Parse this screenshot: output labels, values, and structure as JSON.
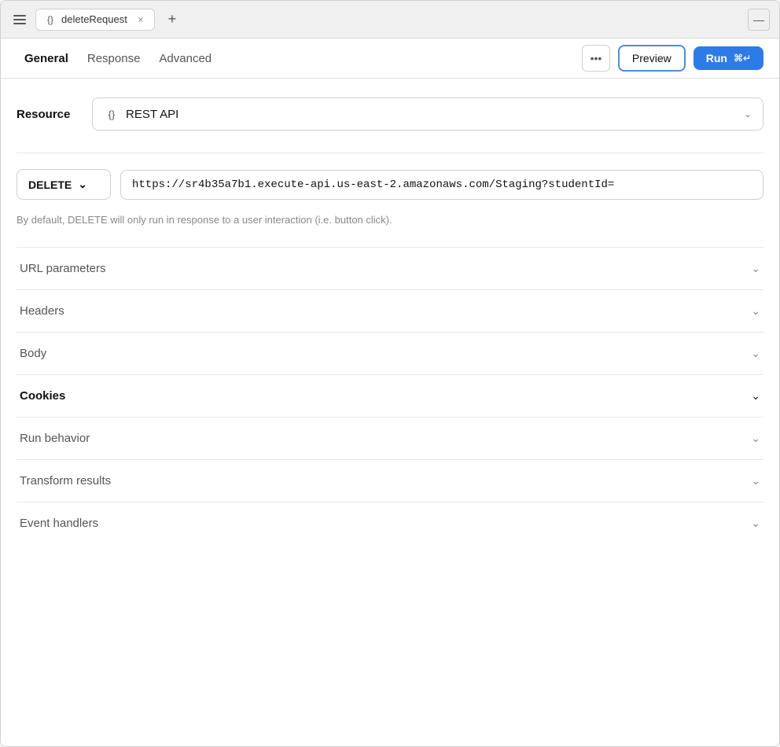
{
  "titleBar": {
    "hamburger_label": "menu",
    "tab_icon": "{}",
    "tab_title": "deleteRequest",
    "tab_close": "×",
    "tab_add": "+",
    "window_minimize": "—"
  },
  "toolbar": {
    "tabs": [
      {
        "id": "general",
        "label": "General",
        "active": true
      },
      {
        "id": "response",
        "label": "Response",
        "active": false
      },
      {
        "id": "advanced",
        "label": "Advanced",
        "active": false
      }
    ],
    "more_label": "•••",
    "preview_label": "Preview",
    "run_label": "Run",
    "run_shortcut": "⌘↵"
  },
  "resource": {
    "label": "Resource",
    "icon": "{}",
    "value": "REST API",
    "chevron": "∨"
  },
  "method": {
    "value": "DELETE",
    "chevron": "∨"
  },
  "url": {
    "value": "https://sr4b35a7b1.execute-api.us-east-2.amazonaws.com/Staging?studentId="
  },
  "helper_text": "By default, DELETE will only run in response to a user interaction (i.e. button click).",
  "sections": [
    {
      "id": "url-parameters",
      "label": "URL parameters",
      "bold": false,
      "open": false
    },
    {
      "id": "headers",
      "label": "Headers",
      "bold": false,
      "open": false
    },
    {
      "id": "body",
      "label": "Body",
      "bold": false,
      "open": false
    },
    {
      "id": "cookies",
      "label": "Cookies",
      "bold": true,
      "open": true
    },
    {
      "id": "run-behavior",
      "label": "Run behavior",
      "bold": false,
      "open": false
    },
    {
      "id": "transform-results",
      "label": "Transform results",
      "bold": false,
      "open": false
    },
    {
      "id": "event-handlers",
      "label": "Event handlers",
      "bold": false,
      "open": false
    }
  ]
}
